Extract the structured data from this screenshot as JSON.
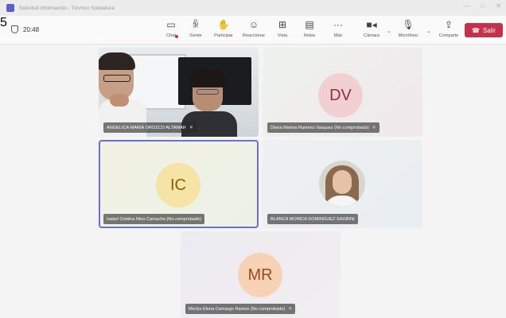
{
  "window": {
    "title": "Solicitud información - Técnico Soldadura"
  },
  "call": {
    "timer": "20:48"
  },
  "toolbar": {
    "chat": "Chat",
    "people": "Gente",
    "people_count": "5",
    "raise_hand": "Participar",
    "react": "Reaccionar",
    "view": "Vista",
    "notes": "Notas",
    "more": "Más",
    "camera": "Cámara",
    "mic": "Micrófono",
    "share": "Comparte",
    "leave": "Salir"
  },
  "participants": [
    {
      "name": "ANGELICA MARIA OROZCO ALTAMAR",
      "type": "video"
    },
    {
      "name": "Diana Marina Ramirez Vasquez (No comprobado)",
      "initials": "DV",
      "type": "initials",
      "avatar_bg": "#f2cfd1",
      "avatar_fg": "#8a3340"
    },
    {
      "name": "Isabel Cristina Nino Camacho (No comprobado)",
      "initials": "IC",
      "type": "initials",
      "avatar_bg": "#f6e3a6",
      "avatar_fg": "#8a5d10",
      "speaking": true
    },
    {
      "name": "BLANCA MONICA DOMINGUEZ SAGBINI",
      "type": "photo"
    },
    {
      "name": "Merlys Elena Camargo Ramos (No comprobado)",
      "initials": "MR",
      "type": "initials",
      "avatar_bg": "#f8d2b5",
      "avatar_fg": "#9a4a1a"
    }
  ],
  "colors": {
    "accent": "#5b5fc7",
    "leave": "#c4314b",
    "speaking_border": "#6a6fd2"
  },
  "icons": [
    "teams-icon",
    "shield-icon",
    "chat-icon",
    "people-icon",
    "hand-icon",
    "smile-icon",
    "grid-icon",
    "notes-icon",
    "more-icon",
    "camera-icon",
    "mic-off-icon",
    "share-icon",
    "phone-icon"
  ]
}
